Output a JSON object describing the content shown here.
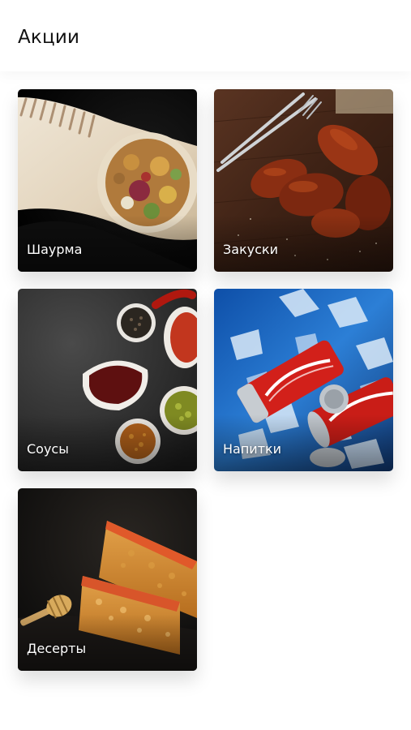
{
  "header": {
    "title": "Акции"
  },
  "categories": [
    {
      "label": "Шаурма",
      "image": "shawarma-photo"
    },
    {
      "label": "Закуски",
      "image": "chicken-wings-photo"
    },
    {
      "label": "Соусы",
      "image": "sauces-photo"
    },
    {
      "label": "Напитки",
      "image": "cola-cans-on-ice-photo"
    },
    {
      "label": "Десерты",
      "image": "baklava-photo"
    }
  ]
}
